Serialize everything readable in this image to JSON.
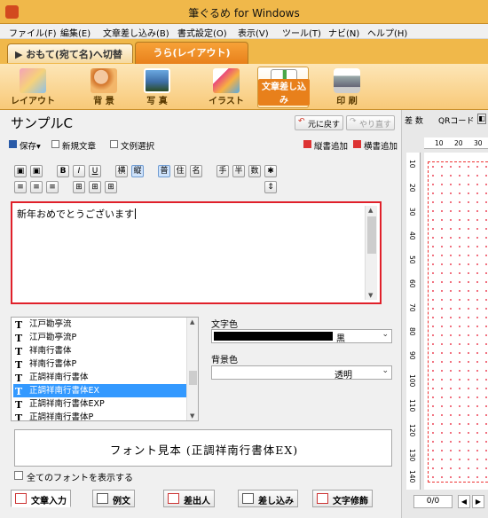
{
  "window": {
    "title": "筆ぐるめ for Windows"
  },
  "menu": [
    "ファイル(F)",
    "編集(E)",
    "文章差し込み(B)",
    "書式設定(O)",
    "表示(V)",
    "ツール(T)",
    "ナビ(N)",
    "ヘルプ(H)"
  ],
  "side_tabs": {
    "omote": "▶ おもて(宛て名)へ切替",
    "ura": "うら(レイアウト)"
  },
  "ribbon": [
    "レイアウト",
    "背 景",
    "写 真",
    "イラスト",
    "文章差し込み",
    "印 刷"
  ],
  "ribbon_active": "文章差し込み",
  "editor": {
    "doc_title": "サンプルC",
    "undo": "元に戻す",
    "redo": "やり直す",
    "save": "保存",
    "new_text": "新規文章",
    "example": "文例選択",
    "add_vertical": "縦書追加",
    "add_horizontal": "横書追加",
    "format_buttons": [
      "B",
      "I",
      "U",
      "横",
      "縦",
      "普",
      "住",
      "名",
      "手",
      "半",
      "数"
    ],
    "text": "新年おめでとうございます"
  },
  "fonts": {
    "items": [
      "江戸勘亭流",
      "江戸勘亭流P",
      "祥南行書体",
      "祥南行書体P",
      "正調祥南行書体",
      "正調祥南行書体EX",
      "正調祥南行書体EXP",
      "正調祥南行書体P"
    ],
    "selected": "正調祥南行書体EX"
  },
  "text_color": {
    "label": "文字色",
    "value": "黒",
    "swatch": "#000000"
  },
  "bg_color": {
    "label": "背景色",
    "value": "透明"
  },
  "preview": "フォント見本 (正調祥南行書体EX)",
  "show_all_fonts": "全てのフォントを表示する",
  "bottom_tabs": [
    "文章入力",
    "例文",
    "差出人",
    "差し込み",
    "文字修飾"
  ],
  "right_panel": {
    "tools": [
      "差 数",
      "QRコード"
    ],
    "ruler_h": [
      "10",
      "20",
      "30"
    ],
    "ruler_v": [
      "10",
      "20",
      "30",
      "40",
      "50",
      "60",
      "70",
      "80",
      "90",
      "100",
      "110",
      "120",
      "130",
      "140"
    ],
    "page": "0/0"
  }
}
